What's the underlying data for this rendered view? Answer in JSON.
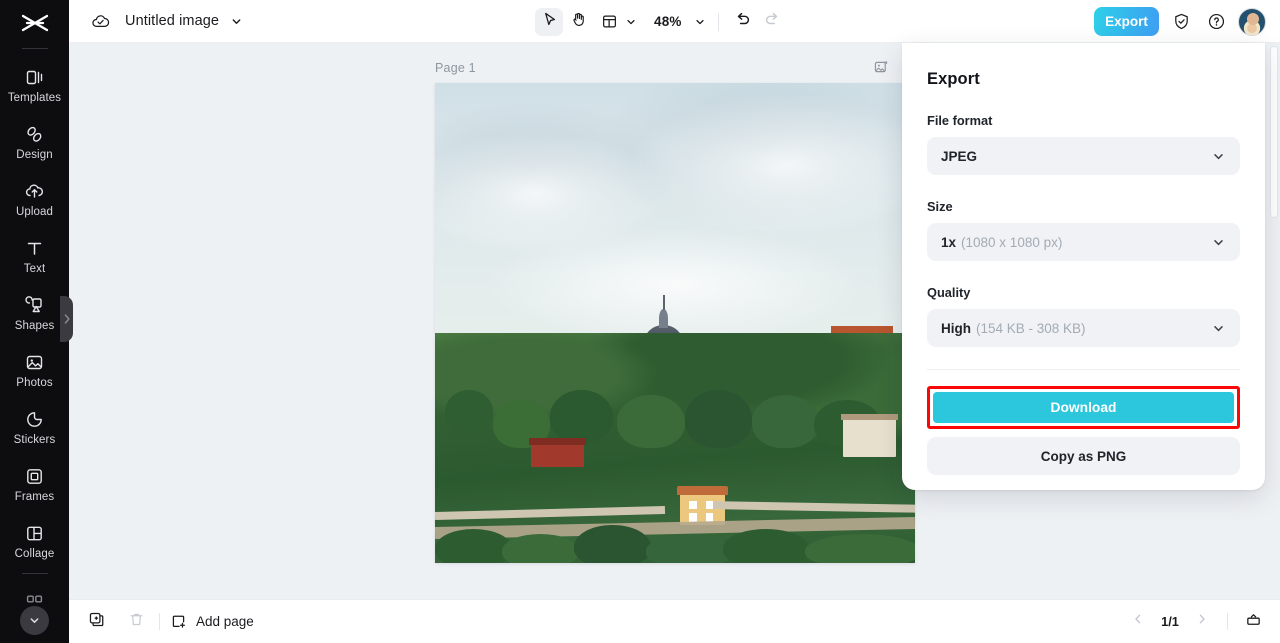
{
  "app": {
    "logo_icon": "capcut-logo-icon",
    "document_title": "Untitled image",
    "cloud_icon": "cloud-saved-icon",
    "title_caret_icon": "chevron-down-icon"
  },
  "sidebar": {
    "items": [
      {
        "label": "Templates",
        "icon": "templates-icon"
      },
      {
        "label": "Design",
        "icon": "design-icon"
      },
      {
        "label": "Upload",
        "icon": "upload-cloud-icon"
      },
      {
        "label": "Text",
        "icon": "text-icon"
      },
      {
        "label": "Shapes",
        "icon": "shapes-icon"
      },
      {
        "label": "Photos",
        "icon": "photos-icon"
      },
      {
        "label": "Stickers",
        "icon": "stickers-icon"
      },
      {
        "label": "Frames",
        "icon": "frames-icon"
      },
      {
        "label": "Collage",
        "icon": "collage-icon"
      }
    ],
    "more_icon": "chevron-down-icon",
    "collapse_handle_icon": "chevron-right-icon"
  },
  "toolbar": {
    "select_icon": "cursor-select-icon",
    "hand_icon": "hand-pan-icon",
    "layout_icon": "layout-icon",
    "layout_caret_icon": "chevron-down-icon",
    "zoom_level": "48%",
    "zoom_caret_icon": "chevron-down-icon",
    "undo_icon": "undo-icon",
    "redo_icon": "redo-icon",
    "export_label": "Export",
    "shield_icon": "shield-check-icon",
    "help_icon": "help-circle-icon",
    "avatar_icon": "user-avatar"
  },
  "canvas": {
    "page_label": "Page 1",
    "page_tool_icon": "resize-page-icon",
    "scrollbar_icon": "vertical-scrollbar"
  },
  "export_panel": {
    "title": "Export",
    "file_format": {
      "label": "File format",
      "value": "JPEG",
      "caret_icon": "chevron-down-icon"
    },
    "size": {
      "label": "Size",
      "value": "1x",
      "detail": "(1080 x 1080 px)",
      "caret_icon": "chevron-down-icon"
    },
    "quality": {
      "label": "Quality",
      "value": "High",
      "detail": "(154 KB - 308 KB)",
      "caret_icon": "chevron-down-icon"
    },
    "download_label": "Download",
    "copy_label": "Copy as PNG",
    "highlight_color": "#fb0707",
    "download_color": "#2cc6dd"
  },
  "bottombar": {
    "duplicate_icon": "duplicate-page-icon",
    "delete_icon": "trash-icon",
    "add_page_icon": "add-page-icon",
    "add_page_label": "Add page",
    "prev_icon": "chevron-left-icon",
    "page_indicator": "1/1",
    "next_icon": "chevron-right-icon",
    "present_icon": "present-icon"
  }
}
